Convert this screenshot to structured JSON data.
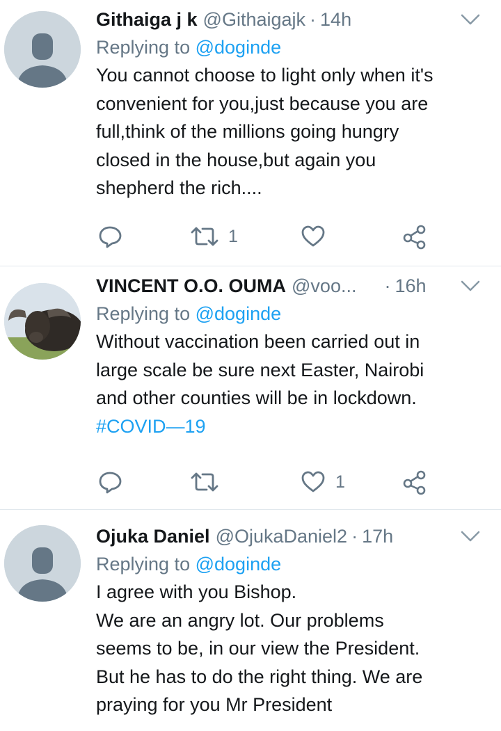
{
  "tweets": [
    {
      "name": "Githaiga j k",
      "handle": "@Githaigajk",
      "separator": "·",
      "time": "14h",
      "replying_prefix": "Replying to",
      "replying_to": "@doginde",
      "text": "You cannot choose to light only when it's\nconvenient for you,just because you are\nfull,think of the millions going hungry\nclosed in the house,but again you\nshepherd the rich....",
      "hashtag": "",
      "retweet_count": "1",
      "like_count": "",
      "avatar": "default-avatar"
    },
    {
      "name": "VINCENT O.O. OUMA",
      "handle": "@voo...",
      "separator": "·",
      "time": "16h",
      "replying_prefix": "Replying to",
      "replying_to": "@doginde",
      "text": "Without vaccination been carried out in\nlarge scale be sure next Easter, Nairobi\nand other counties will be in lockdown.",
      "hashtag": "#COVID—19",
      "retweet_count": "",
      "like_count": "1",
      "avatar": "buffalo-photo"
    },
    {
      "name": "Ojuka Daniel",
      "handle": "@OjukaDaniel2",
      "separator": "·",
      "time": "17h",
      "replying_prefix": "Replying to",
      "replying_to": "@doginde",
      "text": "I agree with you Bishop.\nWe are an angry lot. Our problems\nseems to be, in our view the President.\nBut he has to do the right thing. We are\npraying for you Mr President",
      "hashtag": "",
      "retweet_count": "",
      "like_count": "",
      "avatar": "default-avatar"
    }
  ],
  "colors": {
    "text": "#14171a",
    "muted": "#657786",
    "link": "#1da1f2",
    "divider": "#e1e8ed",
    "avatar_bg": "#ccd6dd",
    "avatar_fg": "#657786"
  }
}
